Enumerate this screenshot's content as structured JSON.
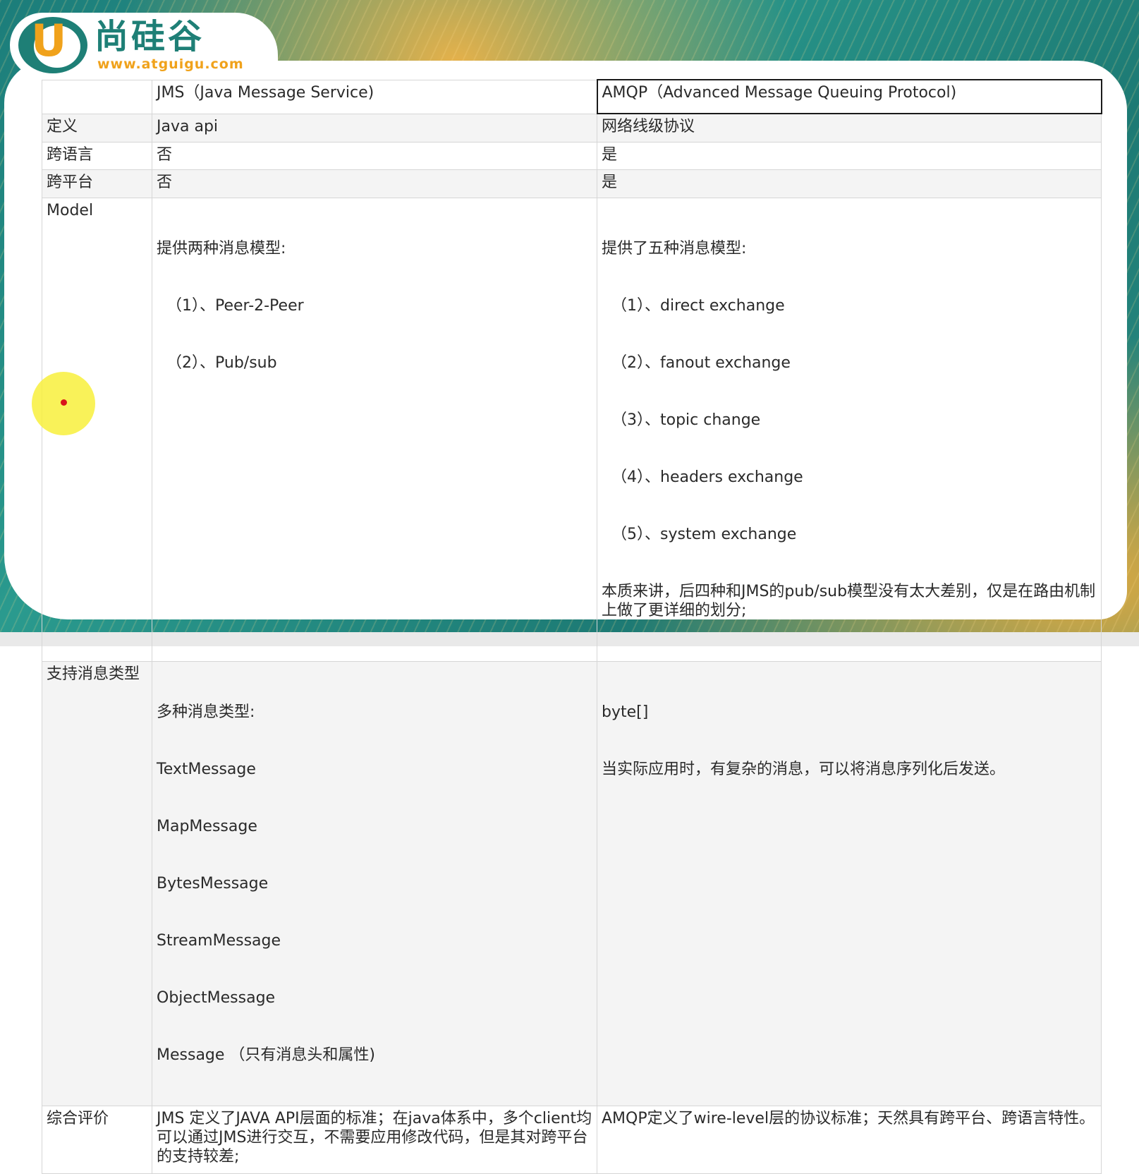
{
  "logo": {
    "letter": "U",
    "name": "尚硅谷",
    "url": "www.atguigu.com"
  },
  "table": {
    "header": {
      "corner": "",
      "col1": "JMS（Java Message Service)",
      "col2": "AMQP（Advanced Message Queuing Protocol)"
    },
    "rows": [
      {
        "label": "定义",
        "jms": [
          "Java api"
        ],
        "amqp": [
          "网络线级协议"
        ]
      },
      {
        "label": "跨语言",
        "jms": [
          "否"
        ],
        "amqp": [
          "是"
        ]
      },
      {
        "label": "跨平台",
        "jms": [
          "否"
        ],
        "amqp": [
          "是"
        ]
      },
      {
        "label": "Model",
        "jms": [
          "提供两种消息模型:",
          "（1）、Peer-2-Peer",
          "（2）、Pub/sub"
        ],
        "amqp": [
          "提供了五种消息模型:",
          "（1）、direct exchange",
          "（2）、fanout exchange",
          "（3）、topic change",
          "（4）、headers exchange",
          "（5）、system exchange",
          "本质来讲，后四种和JMS的pub/sub模型没有太大差别，仅是在路由机制上做了更详细的划分;"
        ]
      },
      {
        "label": "支持消息类型",
        "jms": [
          "多种消息类型:",
          "TextMessage",
          "MapMessage",
          "BytesMessage",
          "StreamMessage",
          "ObjectMessage",
          "Message （只有消息头和属性)"
        ],
        "amqp": [
          "byte[]",
          "当实际应用时，有复杂的消息，可以将消息序列化后发送。"
        ]
      },
      {
        "label": "综合评价",
        "jms": [
          "JMS 定义了JAVA API层面的标准；在java体系中，多个client均可以通过JMS进行交互，不需要应用修改代码，但是其对跨平台的支持较差;"
        ],
        "amqp": [
          "AMQP定义了wire-level层的协议标准；天然具有跨平台、跨语言特性。"
        ]
      }
    ]
  }
}
